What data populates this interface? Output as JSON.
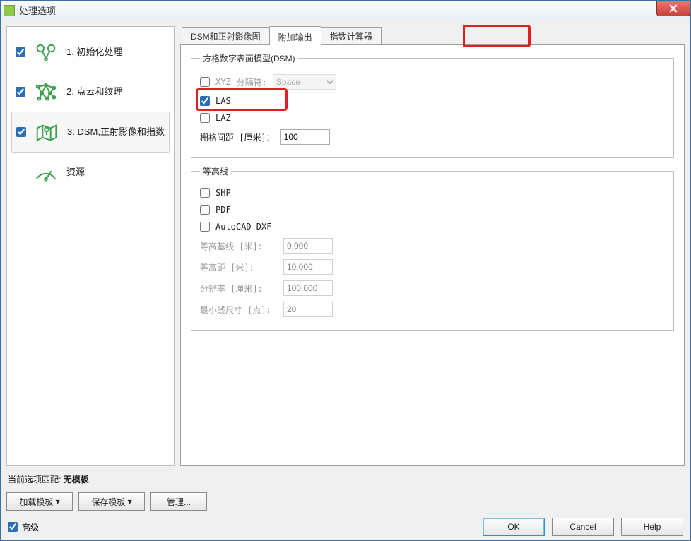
{
  "window": {
    "title": "处理选项"
  },
  "sidebar": {
    "items": [
      {
        "label": "1. 初始化处理",
        "checked": true
      },
      {
        "label": "2. 点云和纹理",
        "checked": true
      },
      {
        "label": "3. DSM,正射影像和指数",
        "checked": true
      },
      {
        "label": "资源",
        "checked": null
      }
    ]
  },
  "tabs": [
    {
      "label": "DSM和正射影像图"
    },
    {
      "label": "附加输出"
    },
    {
      "label": "指数计算器"
    }
  ],
  "active_tab_index": 1,
  "dsm_group": {
    "legend": "方格数字表面模型(DSM)",
    "xyz_label": "XYZ",
    "xyz_checked": false,
    "xyz_sep_label": "分隔符:",
    "xyz_sep_value": "Space",
    "las_label": "LAS",
    "las_checked": true,
    "laz_label": "LAZ",
    "laz_checked": false,
    "grid_label": "栅格间距 [厘米]：",
    "grid_value": "100"
  },
  "contour_group": {
    "legend": "等高线",
    "shp_label": "SHP",
    "shp_checked": false,
    "pdf_label": "PDF",
    "pdf_checked": false,
    "dxf_label": "AutoCAD DXF",
    "dxf_checked": false,
    "base_label": "等高基线 [米]:",
    "base_value": "0.000",
    "interval_label": "等高距 [米]:",
    "interval_value": "10.000",
    "res_label": "分辨率 [厘米]:",
    "res_value": "100.000",
    "min_label": "最小线尺寸 [点]:",
    "min_value": "20"
  },
  "bottom": {
    "match_prefix": "当前选项匹配: ",
    "match_value": "无模板",
    "load_btn": "加载模板",
    "save_btn": "保存模板",
    "manage_btn": "管理...",
    "advanced_label": "高级",
    "advanced_checked": true,
    "ok": "OK",
    "cancel": "Cancel",
    "help": "Help"
  }
}
